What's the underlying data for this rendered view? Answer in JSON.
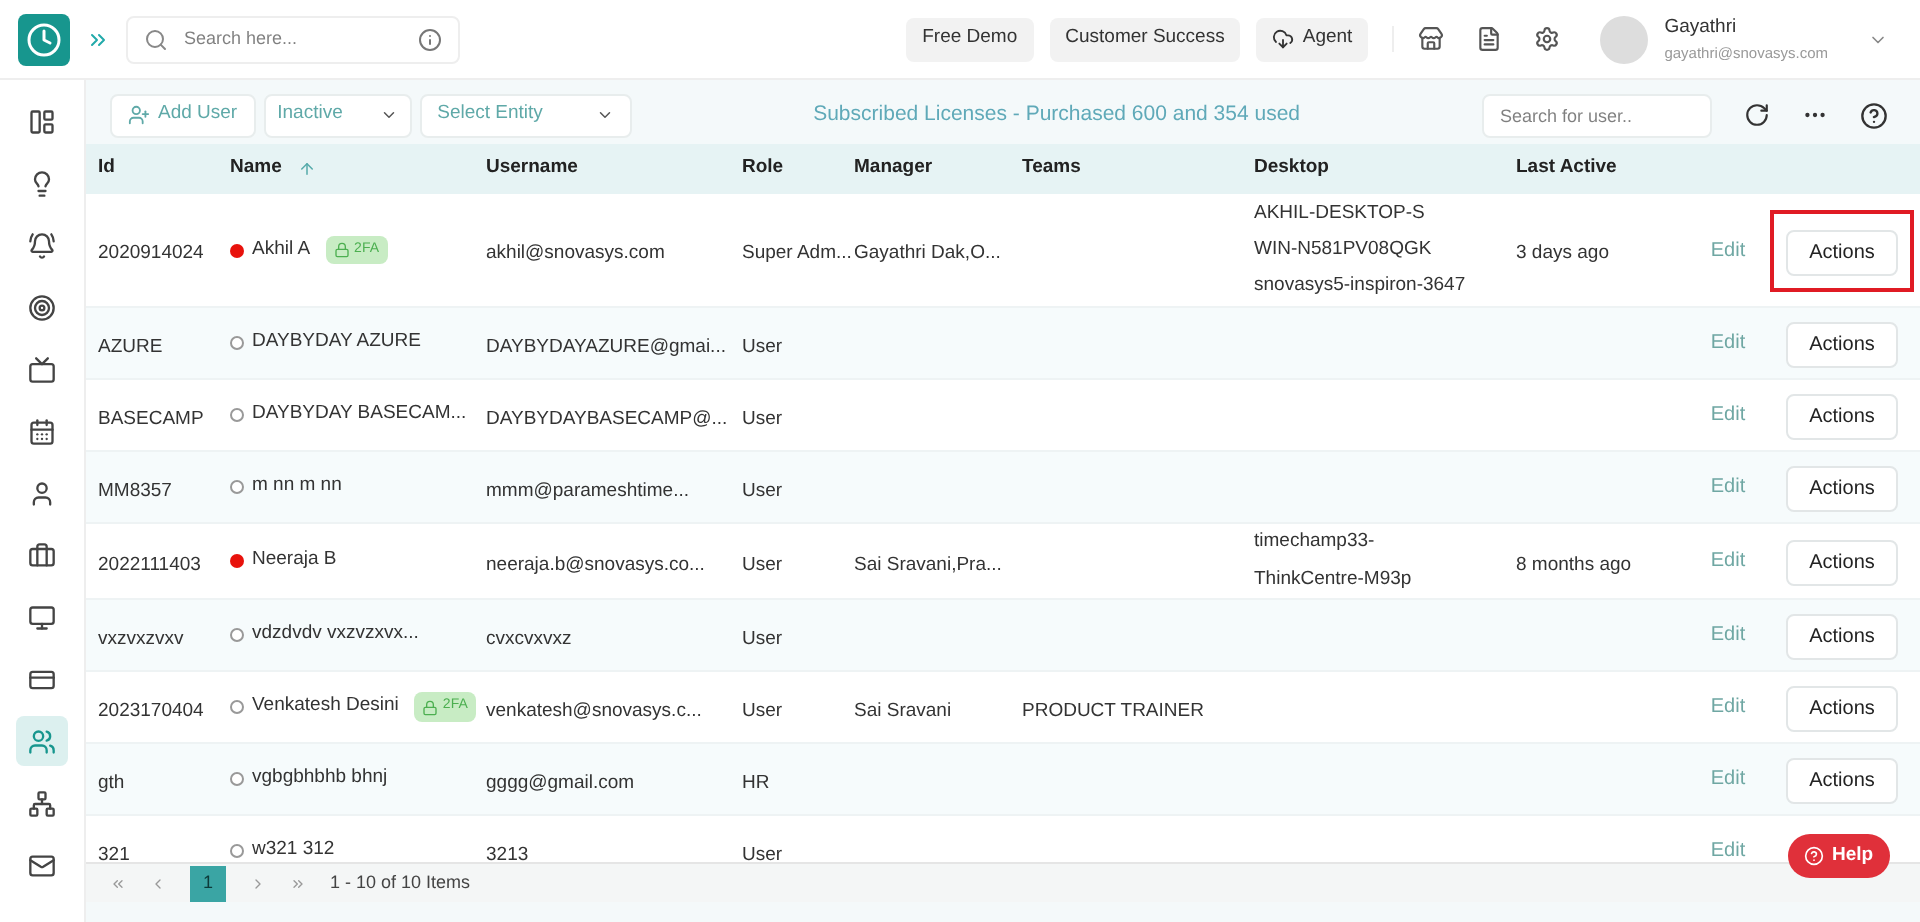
{
  "header": {
    "search": {
      "placeholder": "Search here..."
    },
    "buttons": [
      "Free Demo",
      "Customer Success",
      "Agent"
    ],
    "user": {
      "name": "Gayathri",
      "email": "gayathri@snovasys.com"
    }
  },
  "sidebar": {
    "items": [
      {
        "selected": false
      },
      {
        "selected": false
      },
      {
        "selected": false
      },
      {
        "selected": false
      },
      {
        "selected": false
      },
      {
        "selected": false
      },
      {
        "selected": false
      },
      {
        "selected": false
      },
      {
        "selected": false
      },
      {
        "selected": false
      },
      {
        "selected": true
      },
      {
        "selected": false
      },
      {
        "selected": false
      }
    ]
  },
  "toolbar": {
    "add_user": "Add User",
    "status_filter": "Inactive",
    "entity_filter": "Select Entity",
    "licenses": "Subscribed Licenses - Purchased 600 and 354 used",
    "search": {
      "placeholder": "Search for user.."
    }
  },
  "table": {
    "columns": [
      "Id",
      "Name",
      "Username",
      "Role",
      "Manager",
      "Teams",
      "Desktop",
      "Last Active"
    ],
    "rows": [
      {
        "id": "2020914024",
        "name": "Akhil A",
        "active": true,
        "badge": "2FA",
        "username": "akhil@snovasys.com",
        "role": "Super Adm...",
        "manager": "Gayathri Dak,O...",
        "teams": "",
        "desktop": [
          "AKHIL-DESKTOP-S",
          "WIN-N581PV08QGK",
          "snovasys5-inspiron-3647"
        ],
        "last_active": "3 days ago",
        "edit": "Edit",
        "action": "Actions",
        "highlighted": true
      },
      {
        "id": "AZURE",
        "name": "DAYBYDAY AZURE",
        "active": false,
        "username": "DAYBYDAYAZURE@gmai...",
        "role": "User",
        "edit": "Edit",
        "action": "Actions",
        "highlighted": false
      },
      {
        "id": "BASECAMP",
        "name": "DAYBYDAY BASECAM...",
        "active": false,
        "username": "DAYBYDAYBASECAMP@...",
        "role": "User",
        "edit": "Edit",
        "action": "Actions",
        "highlighted": false
      },
      {
        "id": "MM8357",
        "name": "m nn m nn",
        "active": false,
        "username": "mmm@parameshtime...",
        "role": "User",
        "edit": "Edit",
        "action": "Actions",
        "highlighted": false
      },
      {
        "id": "2022111403",
        "name": "Neeraja B",
        "active": true,
        "username": "neeraja.b@snovasys.co...",
        "role": "User",
        "manager": "Sai Sravani,Pra...",
        "desktop": [
          "timechamp33-",
          "ThinkCentre-M93p"
        ],
        "last_active": "8 months ago",
        "edit": "Edit",
        "action": "Actions",
        "highlighted": false
      },
      {
        "id": "vxzvxzvxv",
        "name": "vdzdvdv vxzvzxvx...",
        "active": false,
        "username": "cvxcvxvxz",
        "role": "User",
        "edit": "Edit",
        "action": "Actions",
        "highlighted": false
      },
      {
        "id": "2023170404",
        "name": "Venkatesh Desini",
        "active": false,
        "badge": "2FA",
        "username": "venkatesh@snovasys.c...",
        "role": "User",
        "manager": "Sai Sravani",
        "teams": "PRODUCT TRAINER",
        "edit": "Edit",
        "action": "Actions",
        "highlighted": false
      },
      {
        "id": "gth",
        "name": "vgbgbhbhb bhnj",
        "active": false,
        "username": "gggg@gmail.com",
        "role": "HR",
        "edit": "Edit",
        "action": "Actions",
        "highlighted": false
      },
      {
        "id": "321",
        "name": "w321 312",
        "active": false,
        "username": "3213",
        "role": "User",
        "edit": "Edit",
        "highlighted": false
      }
    ]
  },
  "pager": {
    "pages": [
      {
        "label": "1",
        "selected": true
      }
    ],
    "summary": "1 - 10 of 10 Items"
  },
  "help": "Help"
}
